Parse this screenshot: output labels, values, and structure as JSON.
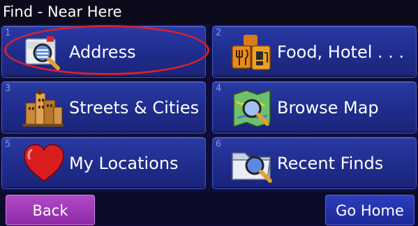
{
  "window": {
    "title": "Find - Near Here"
  },
  "tiles": [
    {
      "number": "1",
      "label": "Address",
      "icon": "address-magnifier-icon"
    },
    {
      "number": "2",
      "label": "Food, Hotel . . .",
      "icon": "food-hotel-icon"
    },
    {
      "number": "3",
      "label": "Streets & Cities",
      "icon": "city-buildings-icon"
    },
    {
      "number": "4",
      "label": "Browse Map",
      "icon": "map-magnifier-icon"
    },
    {
      "number": "5",
      "label": "My Locations",
      "icon": "heart-icon"
    },
    {
      "number": "6",
      "label": "Recent Finds",
      "icon": "folder-magnifier-icon"
    }
  ],
  "footer": {
    "back_label": "Back",
    "home_label": "Go Home"
  },
  "colors": {
    "highlight": "#d8202a",
    "back_button": "#a23bbd",
    "tile": "#2432a0"
  }
}
